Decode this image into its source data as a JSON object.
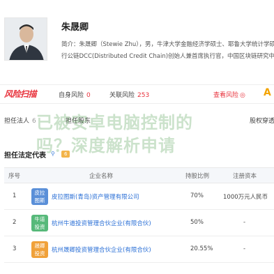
{
  "profile": {
    "name": "朱晟卿",
    "intro_line1": "简介：朱晟卿（Stewie Zhu），男，牛津大学金融经济学硕士、耶鲁大学统计学硕",
    "intro_line2": "行公链DCC(Distributed Credit Chain)创始人兼首席执行官，中国区块链研究中心"
  },
  "risk": {
    "scan_label": "风险扫描",
    "self_risk_label": "自身风险",
    "self_risk_count": "0",
    "related_risk_label": "关联风险",
    "related_risk_count": "253",
    "view_risk_label": "查看风险",
    "view_risk_arrow": "◎",
    "ai_badge": "A"
  },
  "tabs": [
    {
      "label": "担任法人",
      "count": "6"
    },
    {
      "label": "担任股东",
      "count": ""
    },
    {
      "label": "股权穿透",
      "count": ""
    }
  ],
  "watermark": {
    "line1": "已被安卓电脑控制的",
    "line2": "吗？深度解析申请"
  },
  "section": {
    "title": "担任法定代表",
    "icon": "⚲",
    "tag": "6"
  },
  "table": {
    "headers": {
      "index": "序号",
      "company": "企业名称",
      "ratio": "持股比例",
      "capital": "注册资本"
    },
    "rows": [
      {
        "index": "1",
        "logo_text": "皮拉\n图斯",
        "logo_color": "#5a8fd8",
        "company": "皮拉图斯(青岛)资产管理有限公司",
        "ratio": "70%",
        "capital": "1000万元人民币"
      },
      {
        "index": "2",
        "logo_text": "牛道\n投资",
        "logo_color": "#57b97a",
        "company": "杭州牛道投资管理合伙企业(有限合伙)",
        "ratio": "50%",
        "capital": "-"
      },
      {
        "index": "3",
        "logo_text": "晟卿\n投资",
        "logo_color": "#f0a13a",
        "company": "杭州晟卿投资管理合伙企业(有限合伙)",
        "ratio": "20.55%",
        "capital": "-"
      }
    ]
  }
}
